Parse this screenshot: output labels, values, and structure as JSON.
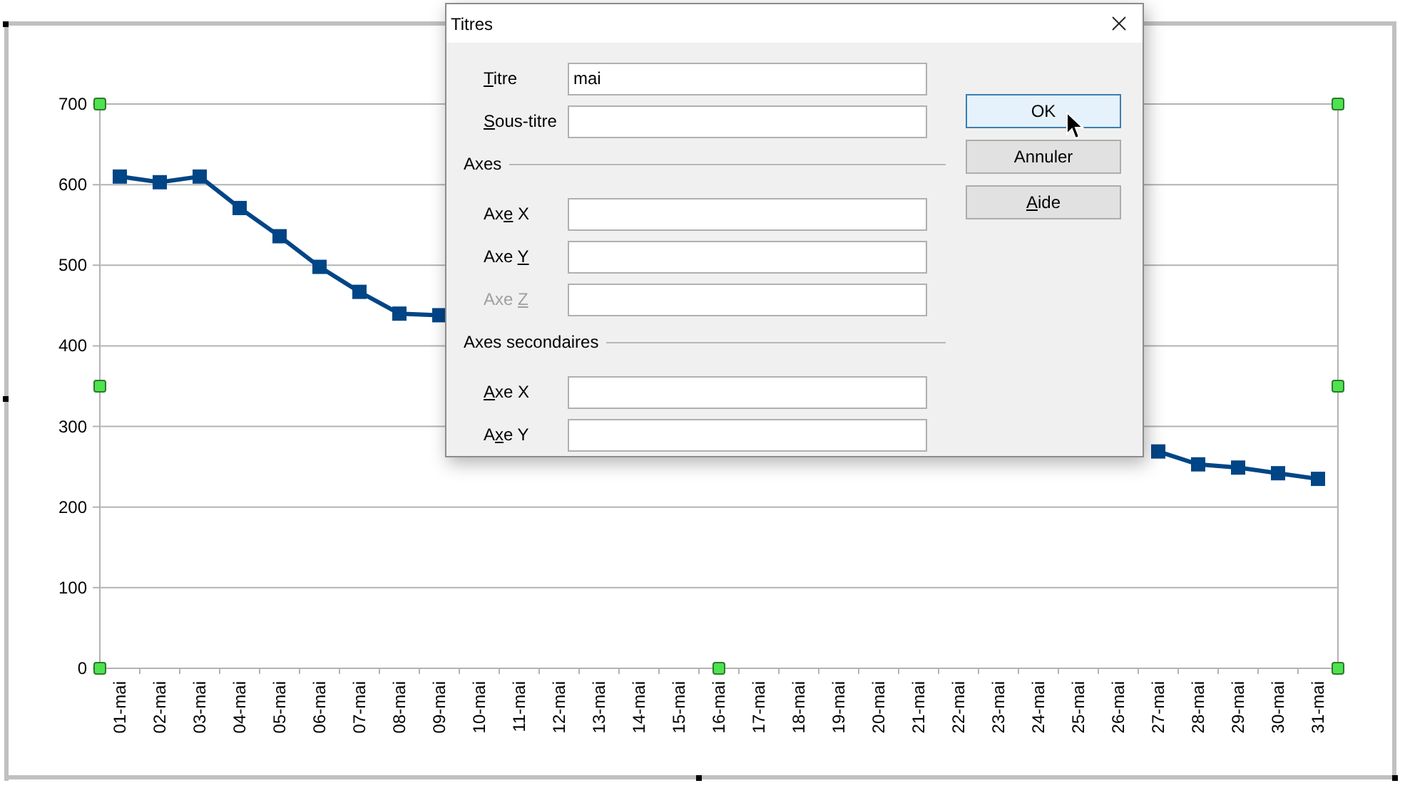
{
  "chart": {
    "chart_data": {
      "type": "line",
      "categories": [
        "01-mai",
        "02-mai",
        "03-mai",
        "04-mai",
        "05-mai",
        "06-mai",
        "07-mai",
        "08-mai",
        "09-mai",
        "10-mai",
        "11-mai",
        "12-mai",
        "13-mai",
        "14-mai",
        "15-mai",
        "16-mai",
        "17-mai",
        "18-mai",
        "19-mai",
        "20-mai",
        "21-mai",
        "22-mai",
        "23-mai",
        "24-mai",
        "25-mai",
        "26-mai",
        "27-mai",
        "28-mai",
        "29-mai",
        "30-mai",
        "31-mai"
      ],
      "series": [
        {
          "color": "#004586",
          "marker": "square",
          "values": [
            610,
            603,
            610,
            571,
            536,
            498,
            467,
            440,
            438,
            null,
            null,
            null,
            null,
            null,
            null,
            null,
            null,
            null,
            null,
            null,
            null,
            null,
            null,
            null,
            null,
            null,
            269,
            253,
            249,
            242,
            235
          ]
        }
      ],
      "ylim": [
        0,
        700
      ],
      "yticks": [
        0,
        100,
        200,
        300,
        400,
        500,
        600,
        700
      ],
      "grid": true
    }
  },
  "dialog": {
    "title": "Titres",
    "groups": [
      {
        "fields": [
          {
            "label_parts": [
              {
                "text": "T",
                "underline": true
              },
              {
                "text": "itre",
                "underline": false
              }
            ],
            "value": "mai",
            "disabled": false
          },
          {
            "label_parts": [
              {
                "text": "S",
                "underline": true
              },
              {
                "text": "ous-titre",
                "underline": false
              }
            ],
            "disabled": false
          }
        ]
      },
      {
        "heading": "Axes",
        "fields": [
          {
            "label_parts": [
              {
                "text": "Ax",
                "underline": false
              },
              {
                "text": "e",
                "underline": true
              },
              {
                "text": " X",
                "underline": false
              }
            ],
            "disabled": false
          },
          {
            "label_parts": [
              {
                "text": "Axe ",
                "underline": false
              },
              {
                "text": "Y",
                "underline": true
              }
            ],
            "disabled": false
          },
          {
            "label_parts": [
              {
                "text": "Axe ",
                "underline": false
              },
              {
                "text": "Z",
                "underline": true
              }
            ],
            "disabled": true
          }
        ]
      },
      {
        "heading": "Axes secondaires",
        "fields": [
          {
            "label_parts": [
              {
                "text": "A",
                "underline": true
              },
              {
                "text": "xe X",
                "underline": false
              }
            ],
            "disabled": false
          },
          {
            "label_parts": [
              {
                "text": "A",
                "underline": false
              },
              {
                "text": "x",
                "underline": true
              },
              {
                "text": "e Y",
                "underline": false
              }
            ],
            "disabled": false
          }
        ]
      }
    ],
    "buttons": [
      {
        "label_parts": [
          {
            "text": "OK",
            "underline": false
          }
        ],
        "default": true
      },
      {
        "label_parts": [
          {
            "text": "Annuler",
            "underline": false
          }
        ],
        "default": false
      },
      {
        "label_parts": [
          {
            "text": "A",
            "underline": true
          },
          {
            "text": "ide",
            "underline": false
          }
        ],
        "default": false
      }
    ]
  }
}
